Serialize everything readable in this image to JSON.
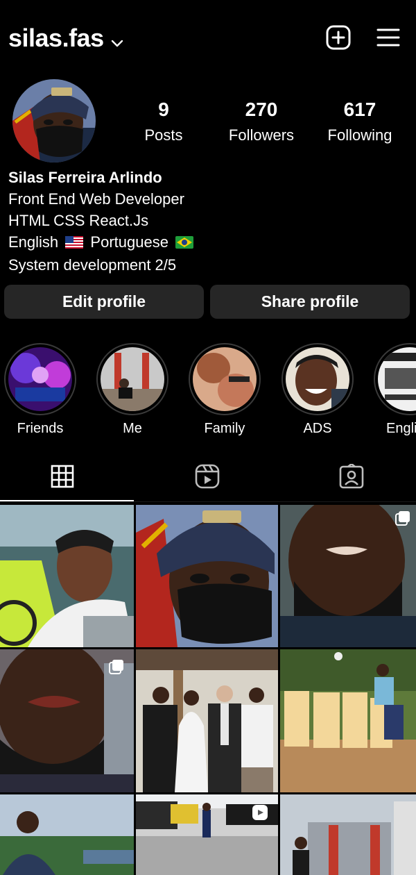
{
  "header": {
    "username": "silas.fas",
    "icons": [
      "chevron-down-icon",
      "create-plus-icon",
      "hamburger-menu-icon"
    ]
  },
  "profile": {
    "stats": [
      {
        "value": "9",
        "label": "Posts"
      },
      {
        "value": "270",
        "label": "Followers"
      },
      {
        "value": "617",
        "label": "Following"
      }
    ],
    "name": "Silas Ferreira Arlindo",
    "bio": {
      "line1": "Front End Web Developer",
      "line2": "HTML CSS React.Js",
      "line3_a": "English",
      "line3_b": "Portuguese",
      "line4": "System development 2/5"
    }
  },
  "actions": {
    "edit": "Edit profile",
    "share": "Share profile"
  },
  "highlights": [
    {
      "label": "Friends"
    },
    {
      "label": "Me"
    },
    {
      "label": "Family"
    },
    {
      "label": "ADS"
    },
    {
      "label": "Engli"
    }
  ],
  "tabs": [
    "grid-icon",
    "reels-icon",
    "tagged-icon"
  ],
  "colors": {
    "background": "#000000",
    "button": "#262626",
    "text": "#ffffff"
  }
}
